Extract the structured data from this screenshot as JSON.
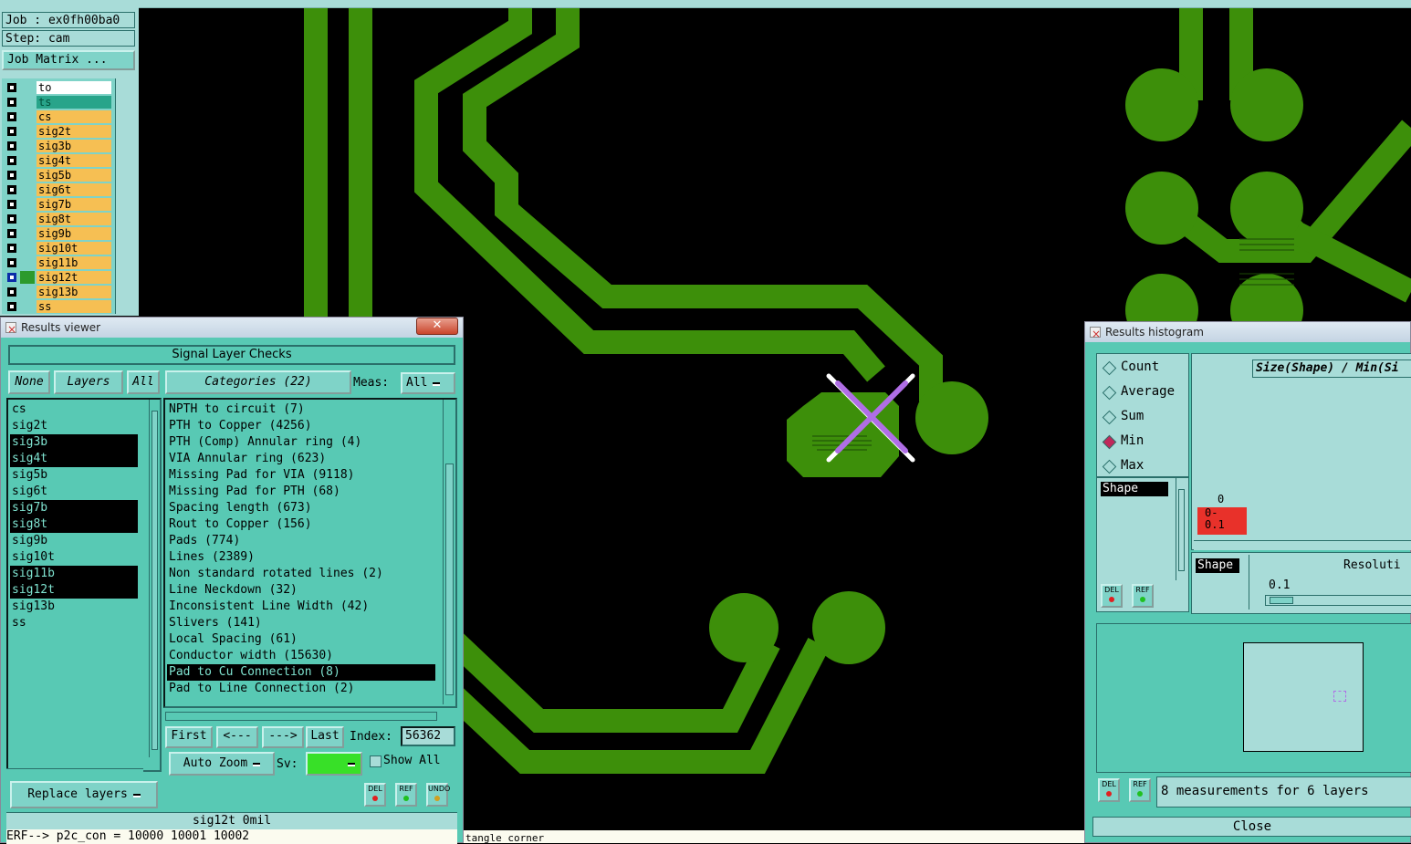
{
  "job": {
    "job_label": "Job : ex0fh00ba0",
    "step_label": "Step: cam",
    "matrix_button": "Job Matrix ..."
  },
  "layers": [
    {
      "name": "to",
      "style": "white",
      "checked": false
    },
    {
      "name": "ts",
      "style": "teal",
      "checked": false
    },
    {
      "name": "cs",
      "style": "orange",
      "checked": false
    },
    {
      "name": "sig2t",
      "style": "orange",
      "checked": false
    },
    {
      "name": "sig3b",
      "style": "orange",
      "checked": false
    },
    {
      "name": "sig4t",
      "style": "orange",
      "checked": false
    },
    {
      "name": "sig5b",
      "style": "orange",
      "checked": false
    },
    {
      "name": "sig6t",
      "style": "orange",
      "checked": false
    },
    {
      "name": "sig7b",
      "style": "orange",
      "checked": false
    },
    {
      "name": "sig8t",
      "style": "orange",
      "checked": false
    },
    {
      "name": "sig9b",
      "style": "orange",
      "checked": false
    },
    {
      "name": "sig10t",
      "style": "orange",
      "checked": false
    },
    {
      "name": "sig11b",
      "style": "orange",
      "checked": false
    },
    {
      "name": "sig12t",
      "style": "orange",
      "checked": true
    },
    {
      "name": "sig13b",
      "style": "orange",
      "checked": false
    },
    {
      "name": "ss",
      "style": "orange",
      "checked": false
    }
  ],
  "results_viewer": {
    "title": "Results viewer",
    "close_glyph": "✕",
    "section_title": "Signal Layer Checks",
    "btn_none": "None",
    "btn_layers": "Layers",
    "btn_all": "All",
    "categories_label": "Categories (22)",
    "meas_label": "Meas:",
    "meas_value": "All",
    "layer_items": [
      {
        "label": "cs",
        "selected": false
      },
      {
        "label": "sig2t",
        "selected": false
      },
      {
        "label": "sig3b",
        "selected": true
      },
      {
        "label": "sig4t",
        "selected": true
      },
      {
        "label": "sig5b",
        "selected": false
      },
      {
        "label": "sig6t",
        "selected": false
      },
      {
        "label": "sig7b",
        "selected": true
      },
      {
        "label": "sig8t",
        "selected": true
      },
      {
        "label": "sig9b",
        "selected": false
      },
      {
        "label": "sig10t",
        "selected": false
      },
      {
        "label": "sig11b",
        "selected": true
      },
      {
        "label": "sig12t",
        "selected": true
      },
      {
        "label": "sig13b",
        "selected": false
      },
      {
        "label": "ss",
        "selected": false
      }
    ],
    "categories": [
      {
        "label": "NPTH to circuit (7)",
        "selected": false
      },
      {
        "label": "PTH to Copper (4256)",
        "selected": false
      },
      {
        "label": "PTH (Comp) Annular ring (4)",
        "selected": false
      },
      {
        "label": "VIA Annular ring (623)",
        "selected": false
      },
      {
        "label": "Missing Pad for VIA (9118)",
        "selected": false
      },
      {
        "label": "Missing Pad for PTH (68)",
        "selected": false
      },
      {
        "label": "Spacing length (673)",
        "selected": false
      },
      {
        "label": "Rout to Copper (156)",
        "selected": false
      },
      {
        "label": "Pads (774)",
        "selected": false
      },
      {
        "label": "Lines (2389)",
        "selected": false
      },
      {
        "label": "Non standard rotated lines (2)",
        "selected": false
      },
      {
        "label": "Line Neckdown (32)",
        "selected": false
      },
      {
        "label": "Inconsistent Line Width (42)",
        "selected": false
      },
      {
        "label": "Slivers (141)",
        "selected": false
      },
      {
        "label": "Local Spacing (61)",
        "selected": false
      },
      {
        "label": "Conductor width (15630)",
        "selected": false
      },
      {
        "label": "Pad to Cu Connection (8)",
        "selected": true
      },
      {
        "label": "Pad to Line Connection (2)",
        "selected": false
      }
    ],
    "nav": {
      "first": "First",
      "prev": "<---",
      "next": "--->",
      "last": "Last",
      "index_label": "Index:",
      "index_value": "56362"
    },
    "auto_zoom": "Auto Zoom",
    "sv_label": "Sv:",
    "show_all": "Show All",
    "replace_layers": "Replace layers",
    "del": "DEL",
    "ref": "REF",
    "undo": "UNDO",
    "status": "sig12t 0mil",
    "err_line": "ERF--> p2c_con = 10000 10001 10002"
  },
  "canvas_text": "tangle corner",
  "histogram": {
    "title": "Results histogram",
    "modes": [
      {
        "label": "Count",
        "selected": false
      },
      {
        "label": "Average",
        "selected": false
      },
      {
        "label": "Sum",
        "selected": false
      },
      {
        "label": "Min",
        "selected": true
      },
      {
        "label": "Max",
        "selected": false
      }
    ],
    "shape_list_item": "Shape",
    "chart_title": "Size(Shape) / Min(Si",
    "bar_count": "0",
    "bar_label": "0-\n0.1",
    "shape_label": "Shape",
    "resolution_label": "Resoluti",
    "resolution_value": "0.1",
    "del": "DEL",
    "ref": "REF",
    "measurements": "8 measurements for 6 layers",
    "close": "Close"
  },
  "colors": {
    "panel": "#58c9b4",
    "panel_light": "#a8dcd8",
    "copper": "#3d8f0a",
    "layer_orange": "#f6bf53",
    "marker": "#b06ee6",
    "bar_red": "#e8312a"
  }
}
